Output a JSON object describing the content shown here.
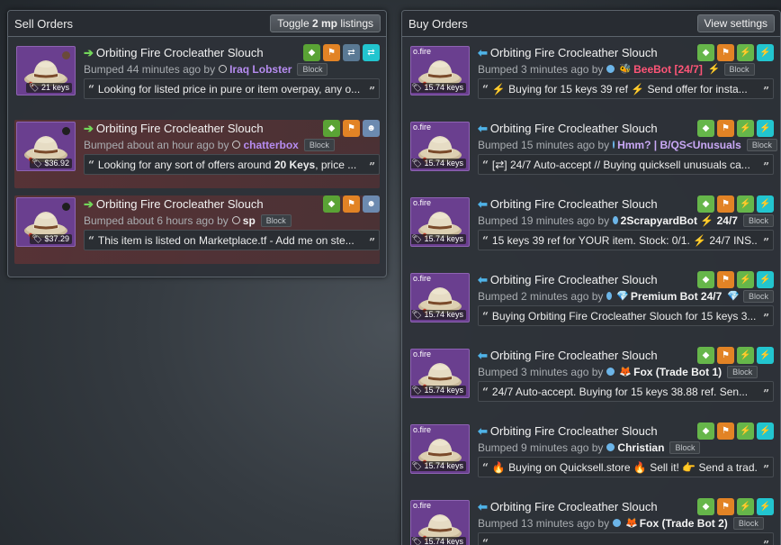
{
  "sell_panel": {
    "title": "Sell Orders",
    "toggle_prefix": "Toggle ",
    "toggle_bold": "2 mp",
    "toggle_suffix": " listings",
    "listings": [
      {
        "item": "Orbiting Fire Crocleather Slouch",
        "price": "21 keys",
        "bumped": "Bumped 44 minutes ago by",
        "user": "Iraq Lobster",
        "block": "Block",
        "message_pre": "Looking for listed price in pure or item overpay, any o...",
        "message_bold": "",
        "message_post": ""
      },
      {
        "item": "Orbiting Fire Crocleather Slouch",
        "price": "$36.92",
        "bumped": "Bumped about an hour ago by",
        "user": "chatterbox",
        "block": "Block",
        "message_pre": "Looking for any sort of offers around ",
        "message_bold": "20 Keys",
        "message_post": ", price ..."
      },
      {
        "item": "Orbiting Fire Crocleather Slouch",
        "price": "$37.29",
        "bumped": "Bumped about 6 hours ago by",
        "user": "sp",
        "block": "Block",
        "message_pre": "This item is listed on Marketplace.tf - Add me on ste...",
        "message_bold": "",
        "message_post": ""
      }
    ]
  },
  "buy_panel": {
    "title": "Buy Orders",
    "view_settings": "View settings",
    "effect_label": "o.fire",
    "listings": [
      {
        "item": "Orbiting Fire Crocleather Slouch",
        "price": "15.74 keys",
        "bumped": "Bumped 3 minutes ago by",
        "user": "BeeBot [24/7]",
        "block": "Block",
        "message": "⚡ Buying for 15 keys 39 ref ⚡ Send offer for insta..."
      },
      {
        "item": "Orbiting Fire Crocleather Slouch",
        "price": "15.74 keys",
        "bumped": "Bumped 15 minutes ago by",
        "user": "Hmm? | B/QS<Unusuals",
        "block": "Block",
        "message": "[⇄] 24/7 Auto-accept // Buying quicksell unusuals ca..."
      },
      {
        "item": "Orbiting Fire Crocleather Slouch",
        "price": "15.74 keys",
        "bumped": "Bumped 19 minutes ago by",
        "user": "2ScrapyardBot ⚡ 24/7",
        "block": "Block",
        "message": "15 keys 39 ref for YOUR item. Stock: 0/1. ⚡ 24/7 INS..."
      },
      {
        "item": "Orbiting Fire Crocleather Slouch",
        "price": "15.74 keys",
        "bumped": "Bumped 2 minutes ago by",
        "user": "Premium Bot 24/7",
        "block": "Block",
        "message": "Buying Orbiting Fire Crocleather Slouch for 15 keys 3..."
      },
      {
        "item": "Orbiting Fire Crocleather Slouch",
        "price": "15.74 keys",
        "bumped": "Bumped 3 minutes ago by",
        "user": "Fox (Trade Bot 1)",
        "block": "Block",
        "message": "24/7 Auto-accept. Buying for 15 keys 38.88 ref. Sen..."
      },
      {
        "item": "Orbiting Fire Crocleather Slouch",
        "price": "15.74 keys",
        "bumped": "Bumped 9 minutes ago by",
        "user": "Christian",
        "block": "Block",
        "message": "🔥 Buying on Quicksell.store 🔥 Sell it! 👉 Send a trad..."
      },
      {
        "item": "Orbiting Fire Crocleather Slouch",
        "price": "15.74 keys",
        "bumped": "Bumped 13 minutes ago by",
        "user": "Fox (Trade Bot 2)",
        "block": "Block",
        "message": ""
      }
    ]
  },
  "colors": {
    "sell_highlight": "#7a3434",
    "item_bg": "#6a3f8f",
    "green_button": "#5aa335",
    "orange_button": "#e28325",
    "teal_button": "#22c5cf"
  }
}
